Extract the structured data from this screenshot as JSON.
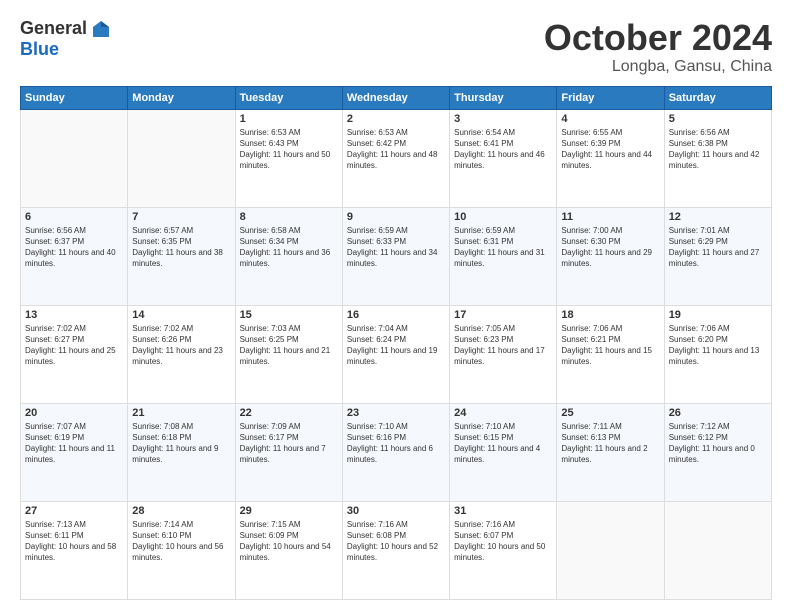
{
  "header": {
    "logo_general": "General",
    "logo_blue": "Blue",
    "month": "October 2024",
    "location": "Longba, Gansu, China"
  },
  "weekdays": [
    "Sunday",
    "Monday",
    "Tuesday",
    "Wednesday",
    "Thursday",
    "Friday",
    "Saturday"
  ],
  "weeks": [
    [
      {
        "day": "",
        "info": ""
      },
      {
        "day": "",
        "info": ""
      },
      {
        "day": "1",
        "info": "Sunrise: 6:53 AM\nSunset: 6:43 PM\nDaylight: 11 hours and 50 minutes."
      },
      {
        "day": "2",
        "info": "Sunrise: 6:53 AM\nSunset: 6:42 PM\nDaylight: 11 hours and 48 minutes."
      },
      {
        "day": "3",
        "info": "Sunrise: 6:54 AM\nSunset: 6:41 PM\nDaylight: 11 hours and 46 minutes."
      },
      {
        "day": "4",
        "info": "Sunrise: 6:55 AM\nSunset: 6:39 PM\nDaylight: 11 hours and 44 minutes."
      },
      {
        "day": "5",
        "info": "Sunrise: 6:56 AM\nSunset: 6:38 PM\nDaylight: 11 hours and 42 minutes."
      }
    ],
    [
      {
        "day": "6",
        "info": "Sunrise: 6:56 AM\nSunset: 6:37 PM\nDaylight: 11 hours and 40 minutes."
      },
      {
        "day": "7",
        "info": "Sunrise: 6:57 AM\nSunset: 6:35 PM\nDaylight: 11 hours and 38 minutes."
      },
      {
        "day": "8",
        "info": "Sunrise: 6:58 AM\nSunset: 6:34 PM\nDaylight: 11 hours and 36 minutes."
      },
      {
        "day": "9",
        "info": "Sunrise: 6:59 AM\nSunset: 6:33 PM\nDaylight: 11 hours and 34 minutes."
      },
      {
        "day": "10",
        "info": "Sunrise: 6:59 AM\nSunset: 6:31 PM\nDaylight: 11 hours and 31 minutes."
      },
      {
        "day": "11",
        "info": "Sunrise: 7:00 AM\nSunset: 6:30 PM\nDaylight: 11 hours and 29 minutes."
      },
      {
        "day": "12",
        "info": "Sunrise: 7:01 AM\nSunset: 6:29 PM\nDaylight: 11 hours and 27 minutes."
      }
    ],
    [
      {
        "day": "13",
        "info": "Sunrise: 7:02 AM\nSunset: 6:27 PM\nDaylight: 11 hours and 25 minutes."
      },
      {
        "day": "14",
        "info": "Sunrise: 7:02 AM\nSunset: 6:26 PM\nDaylight: 11 hours and 23 minutes."
      },
      {
        "day": "15",
        "info": "Sunrise: 7:03 AM\nSunset: 6:25 PM\nDaylight: 11 hours and 21 minutes."
      },
      {
        "day": "16",
        "info": "Sunrise: 7:04 AM\nSunset: 6:24 PM\nDaylight: 11 hours and 19 minutes."
      },
      {
        "day": "17",
        "info": "Sunrise: 7:05 AM\nSunset: 6:23 PM\nDaylight: 11 hours and 17 minutes."
      },
      {
        "day": "18",
        "info": "Sunrise: 7:06 AM\nSunset: 6:21 PM\nDaylight: 11 hours and 15 minutes."
      },
      {
        "day": "19",
        "info": "Sunrise: 7:06 AM\nSunset: 6:20 PM\nDaylight: 11 hours and 13 minutes."
      }
    ],
    [
      {
        "day": "20",
        "info": "Sunrise: 7:07 AM\nSunset: 6:19 PM\nDaylight: 11 hours and 11 minutes."
      },
      {
        "day": "21",
        "info": "Sunrise: 7:08 AM\nSunset: 6:18 PM\nDaylight: 11 hours and 9 minutes."
      },
      {
        "day": "22",
        "info": "Sunrise: 7:09 AM\nSunset: 6:17 PM\nDaylight: 11 hours and 7 minutes."
      },
      {
        "day": "23",
        "info": "Sunrise: 7:10 AM\nSunset: 6:16 PM\nDaylight: 11 hours and 6 minutes."
      },
      {
        "day": "24",
        "info": "Sunrise: 7:10 AM\nSunset: 6:15 PM\nDaylight: 11 hours and 4 minutes."
      },
      {
        "day": "25",
        "info": "Sunrise: 7:11 AM\nSunset: 6:13 PM\nDaylight: 11 hours and 2 minutes."
      },
      {
        "day": "26",
        "info": "Sunrise: 7:12 AM\nSunset: 6:12 PM\nDaylight: 11 hours and 0 minutes."
      }
    ],
    [
      {
        "day": "27",
        "info": "Sunrise: 7:13 AM\nSunset: 6:11 PM\nDaylight: 10 hours and 58 minutes."
      },
      {
        "day": "28",
        "info": "Sunrise: 7:14 AM\nSunset: 6:10 PM\nDaylight: 10 hours and 56 minutes."
      },
      {
        "day": "29",
        "info": "Sunrise: 7:15 AM\nSunset: 6:09 PM\nDaylight: 10 hours and 54 minutes."
      },
      {
        "day": "30",
        "info": "Sunrise: 7:16 AM\nSunset: 6:08 PM\nDaylight: 10 hours and 52 minutes."
      },
      {
        "day": "31",
        "info": "Sunrise: 7:16 AM\nSunset: 6:07 PM\nDaylight: 10 hours and 50 minutes."
      },
      {
        "day": "",
        "info": ""
      },
      {
        "day": "",
        "info": ""
      }
    ]
  ]
}
